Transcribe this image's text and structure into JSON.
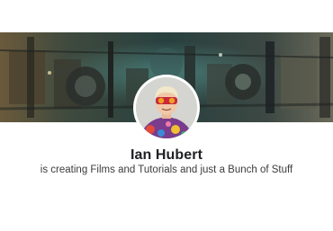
{
  "creator": {
    "name": "Ian Hubert",
    "tagline": "is creating Films and Tutorials and just a Bunch of Stuff"
  },
  "colors": {
    "background": "#ffffff",
    "name_text": "#202124",
    "tagline_text": "#3a3b3d",
    "banner_base": "#2b3430"
  },
  "images": {
    "banner": "sci-fi-machinery-cover-image",
    "avatar": "creator-profile-photo"
  }
}
